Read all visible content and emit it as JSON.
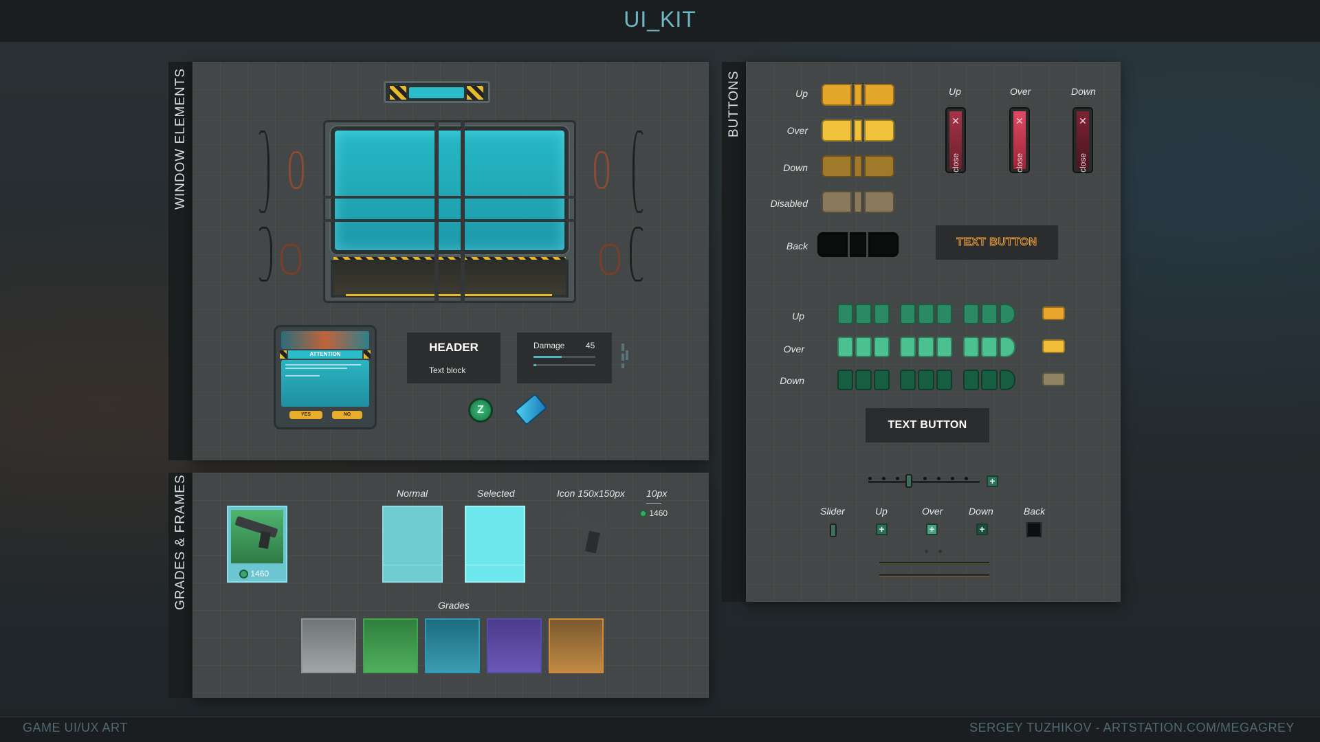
{
  "title": "UI_KIT",
  "footer": {
    "left": "GAME UI/UX ART",
    "right": "SERGEY TUZHIKOV  -  ARTSTATION.COM/MEGAGREY"
  },
  "sections": {
    "window": "WINDOW ELEMENTS",
    "buttons": "BUTTONS",
    "grades": "GRADES & FRAMES"
  },
  "window": {
    "dialog": {
      "title": "ATTENTION",
      "yes": "YES",
      "no": "NO"
    },
    "header_box": {
      "header": "HEADER",
      "text": "Text block"
    },
    "damage": {
      "label": "Damage",
      "value": "45",
      "progress": 0.45
    }
  },
  "buttons": {
    "yellow_states": [
      "Up",
      "Over",
      "Down",
      "Disabled",
      "Back"
    ],
    "close_states": [
      "Up",
      "Over",
      "Down"
    ],
    "close_label": "close",
    "text_button_orange": "TEXT BUTTON",
    "green_states": [
      "Up",
      "Over",
      "Down"
    ],
    "text_button_white": "TEXT BUTTON",
    "small_labels": [
      "Slider",
      "Up",
      "Over",
      "Down",
      "Back"
    ]
  },
  "grades": {
    "columns": {
      "normal": "Normal",
      "selected": "Selected",
      "icon": "Icon 150x150px",
      "spacing": "10px"
    },
    "price": "1460",
    "grades_label": "Grades"
  },
  "colors": {
    "accent": "#6fb8c4",
    "cyan": "#27b9c6",
    "yellow": "#e9b92c",
    "green": "#2f8a62"
  }
}
